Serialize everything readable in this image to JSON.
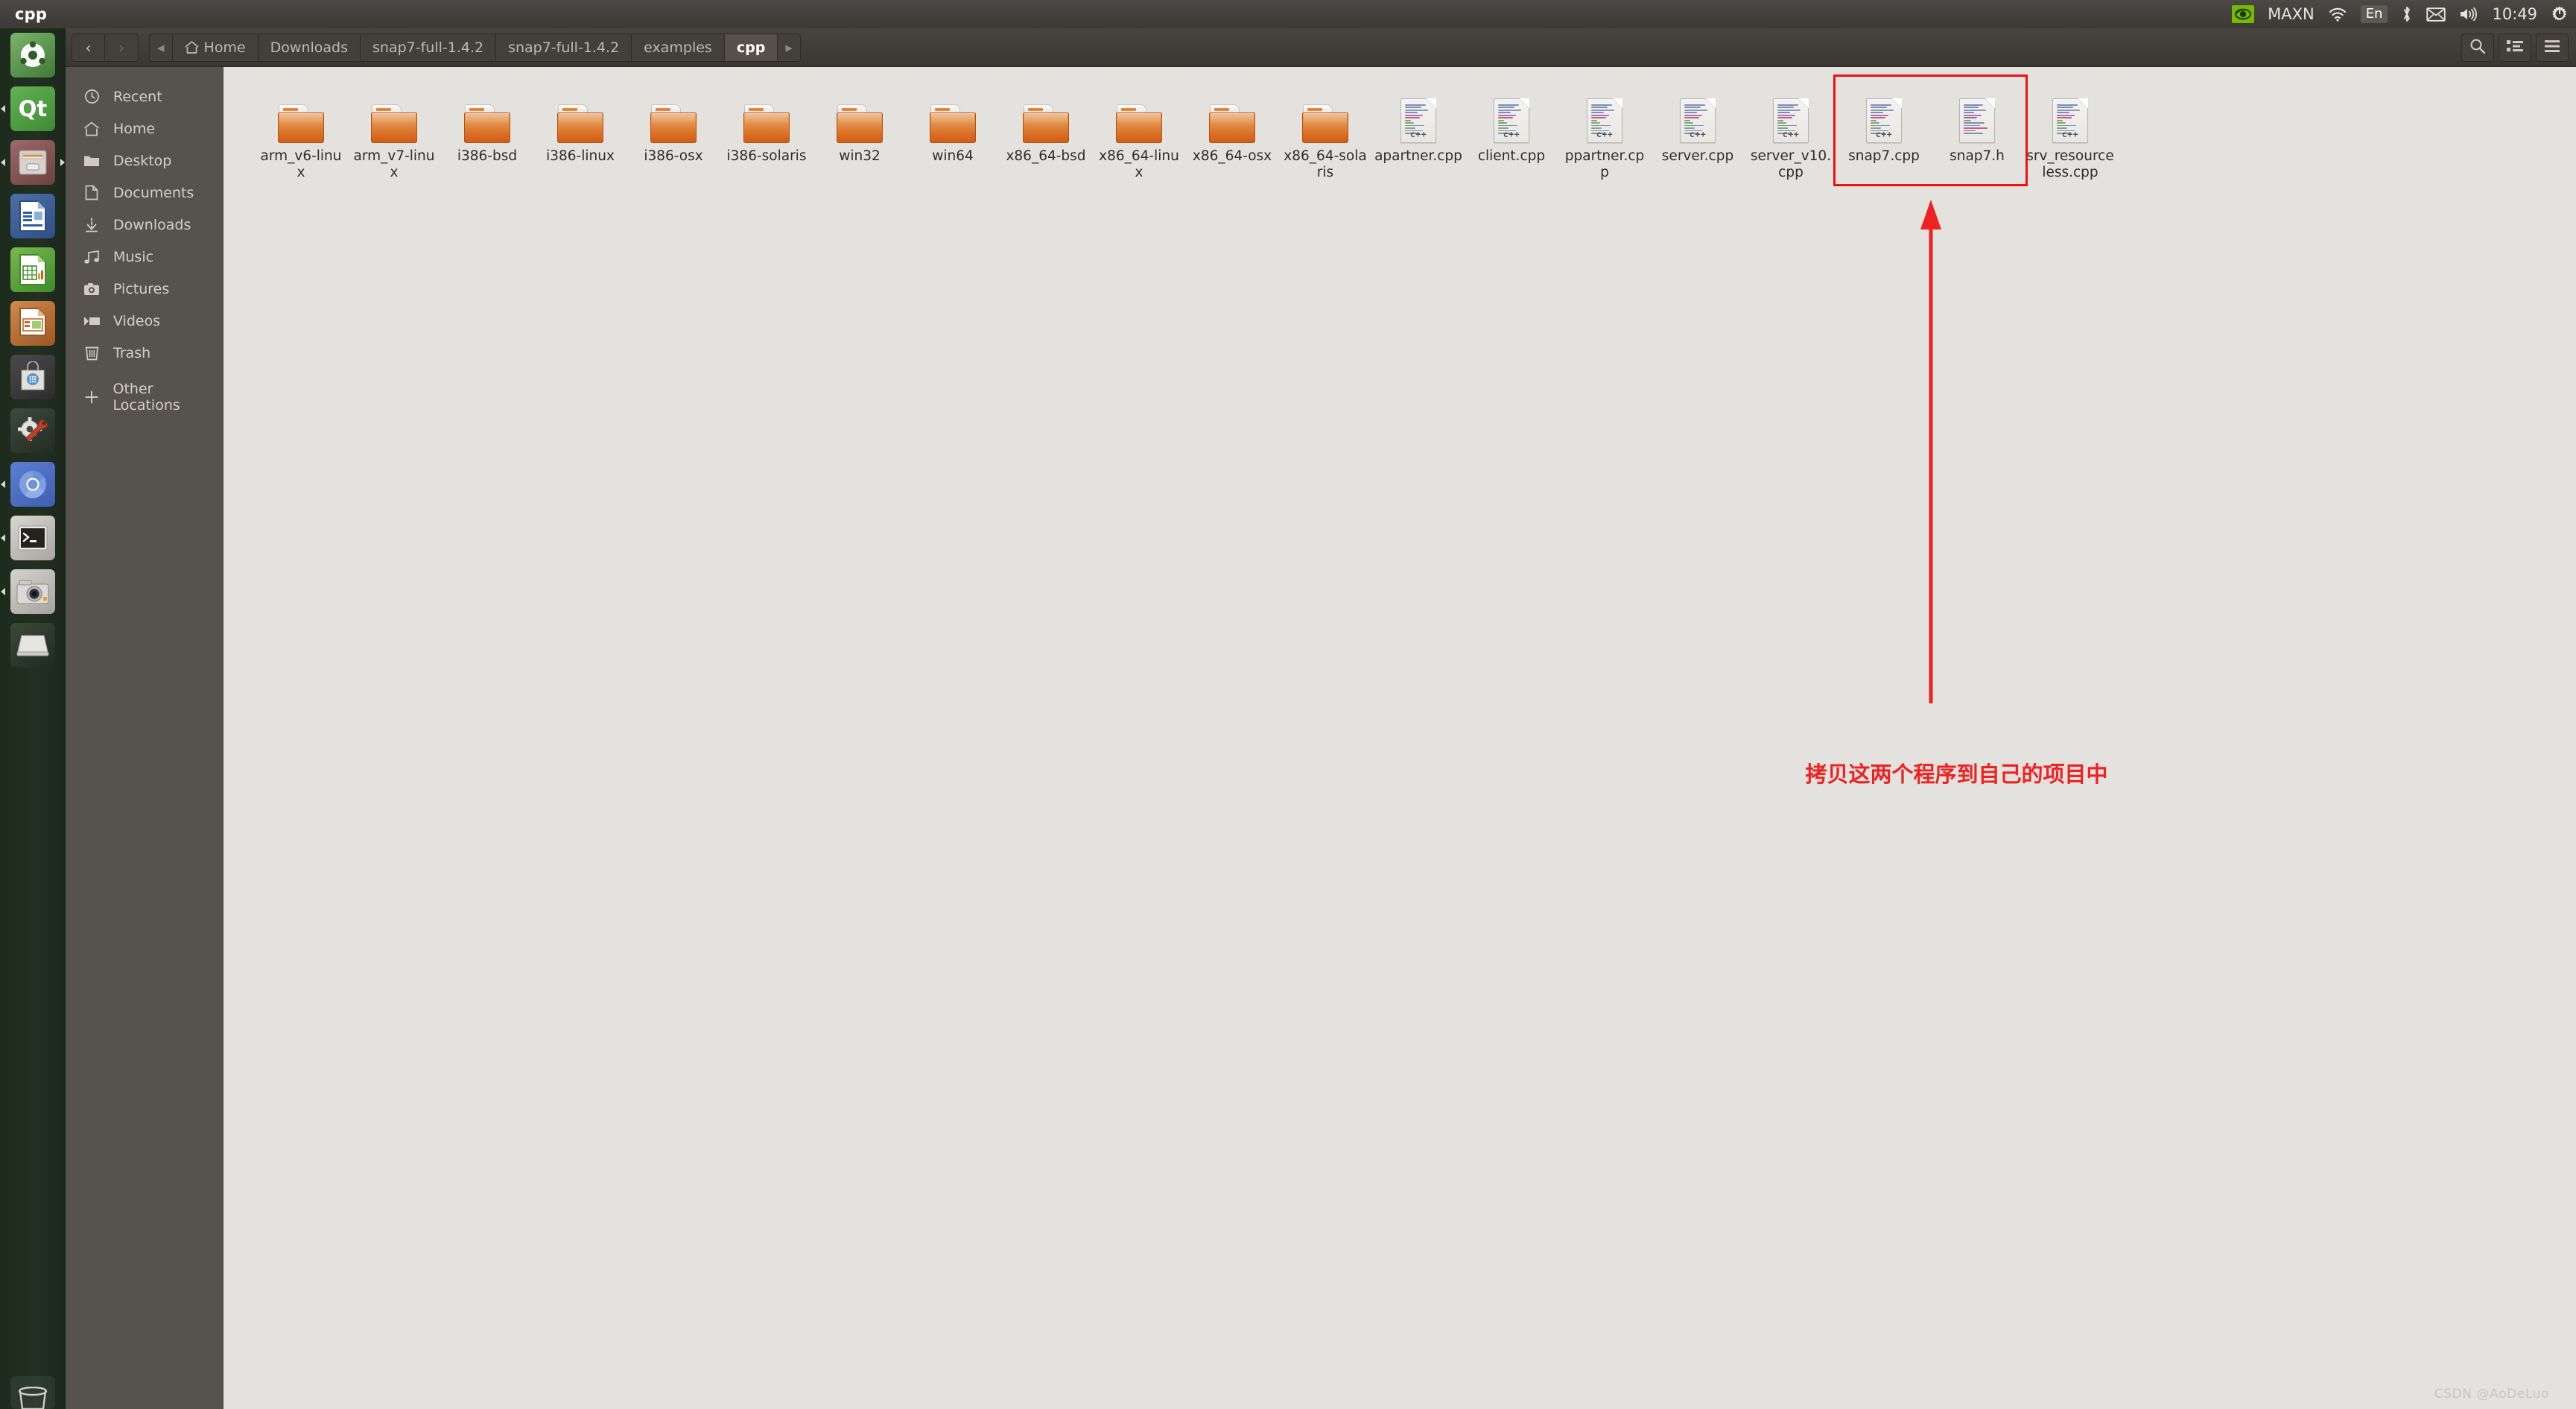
{
  "panel": {
    "title": "cpp",
    "indicators": {
      "gpu_mode": "MAXN",
      "language": "En",
      "clock": "10:49",
      "icons": [
        "nvidia-icon",
        "wifi-icon",
        "bluetooth-icon",
        "mail-icon",
        "volume-icon",
        "power-icon"
      ]
    }
  },
  "launcher": {
    "items": [
      {
        "name": "ubuntu-dash",
        "label": "Ubuntu Dash"
      },
      {
        "name": "qt-creator",
        "label": "Qt Creator"
      },
      {
        "name": "files-nautilus",
        "label": "Files"
      },
      {
        "name": "libreoffice-writer",
        "label": "LibreOffice Writer"
      },
      {
        "name": "libreoffice-calc",
        "label": "LibreOffice Calc"
      },
      {
        "name": "libreoffice-impress",
        "label": "LibreOffice Impress"
      },
      {
        "name": "ubuntu-software",
        "label": "Ubuntu Software"
      },
      {
        "name": "system-settings",
        "label": "System Settings"
      },
      {
        "name": "chromium-browser",
        "label": "Chromium"
      },
      {
        "name": "terminal",
        "label": "Terminal"
      },
      {
        "name": "camera",
        "label": "Camera"
      },
      {
        "name": "disk-drive",
        "label": "Disk"
      }
    ],
    "trash_label": "Trash"
  },
  "headerbar": {
    "back_label": "‹",
    "forward_label": "›",
    "breadcrumb_prev_label": "◂",
    "breadcrumb_next_label": "▸",
    "crumbs": [
      {
        "label": "Home",
        "icon": "home-icon",
        "active": false
      },
      {
        "label": "Downloads",
        "icon": "",
        "active": false
      },
      {
        "label": "snap7-full-1.4.2",
        "icon": "",
        "active": false
      },
      {
        "label": "snap7-full-1.4.2",
        "icon": "",
        "active": false
      },
      {
        "label": "examples",
        "icon": "",
        "active": false
      },
      {
        "label": "cpp",
        "icon": "",
        "active": true
      }
    ],
    "right_buttons": [
      {
        "name": "search-button",
        "icon": "search-icon"
      },
      {
        "name": "view-toggle-button",
        "icon": "list-view-icon"
      },
      {
        "name": "menu-button",
        "icon": "hamburger-menu-icon"
      }
    ]
  },
  "sidebar": {
    "items": [
      {
        "label": "Recent",
        "icon": "clock-icon"
      },
      {
        "label": "Home",
        "icon": "home-icon"
      },
      {
        "label": "Desktop",
        "icon": "folder-icon"
      },
      {
        "label": "Documents",
        "icon": "document-icon"
      },
      {
        "label": "Downloads",
        "icon": "download-icon"
      },
      {
        "label": "Music",
        "icon": "music-note-icon"
      },
      {
        "label": "Pictures",
        "icon": "camera-icon"
      },
      {
        "label": "Videos",
        "icon": "video-icon"
      },
      {
        "label": "Trash",
        "icon": "trash-icon"
      },
      {
        "label": "Other Locations",
        "icon": "plus-icon"
      }
    ]
  },
  "files": [
    {
      "name": "arm_v6-linux",
      "type": "folder"
    },
    {
      "name": "arm_v7-linux",
      "type": "folder"
    },
    {
      "name": "i386-bsd",
      "type": "folder"
    },
    {
      "name": "i386-linux",
      "type": "folder"
    },
    {
      "name": "i386-osx",
      "type": "folder"
    },
    {
      "name": "i386-solaris",
      "type": "folder"
    },
    {
      "name": "win32",
      "type": "folder"
    },
    {
      "name": "win64",
      "type": "folder"
    },
    {
      "name": "x86_64-bsd",
      "type": "folder"
    },
    {
      "name": "x86_64-linux",
      "type": "folder"
    },
    {
      "name": "x86_64-osx",
      "type": "folder"
    },
    {
      "name": "x86_64-solaris",
      "type": "folder"
    },
    {
      "name": "apartner.cpp",
      "type": "cpp"
    },
    {
      "name": "client.cpp",
      "type": "cpp"
    },
    {
      "name": "ppartner.cpp",
      "type": "cpp"
    },
    {
      "name": "server.cpp",
      "type": "cpp"
    },
    {
      "name": "server_v10.cpp",
      "type": "cpp"
    },
    {
      "name": "snap7.cpp",
      "type": "cpp"
    },
    {
      "name": "snap7.h",
      "type": "header"
    },
    {
      "name": "srv_resourceless.cpp",
      "type": "cpp"
    }
  ],
  "annotation": {
    "text": "拷贝这两个程序到自己的项目中",
    "color": "#ee2222",
    "highlight_files": [
      "snap7.cpp",
      "snap7.h"
    ]
  },
  "watermark": "CSDN @AoDeLuo"
}
